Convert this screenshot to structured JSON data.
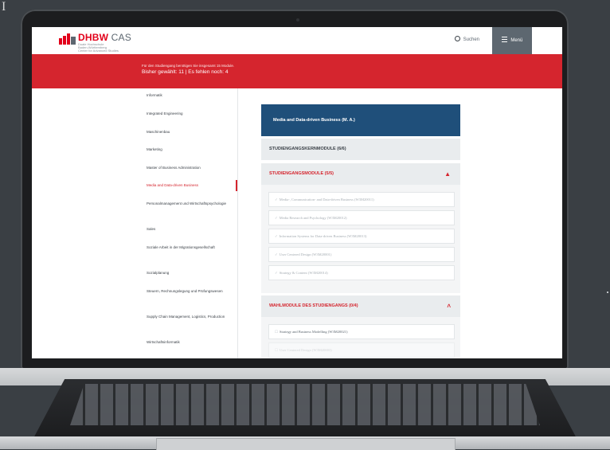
{
  "corner_text": "I",
  "header": {
    "logo_text": "DHBW",
    "logo_suffix": "CAS",
    "logo_sub1": "Duale Hochschule",
    "logo_sub2": "Baden-Württemberg",
    "logo_sub3": "Center for Advanced Studies",
    "search_label": "Suchen",
    "menu_label": "Menü"
  },
  "banner": {
    "line1": "Für den Studiengang benötigen Sie insgesamt 15 Module.",
    "line2": "Bisher gewählt: 11 | Es fehlen noch: 4"
  },
  "sidebar": {
    "items": [
      {
        "label": "Informatik"
      },
      {
        "label": "Integrated Engineering"
      },
      {
        "label": "Maschinenbau"
      },
      {
        "label": "Marketing"
      },
      {
        "label": "Master of Business Administration"
      },
      {
        "label": "Media and Data-driven Business"
      },
      {
        "label": "Personalmanagement und Wirtschaftspsychologie"
      },
      {
        "label": "Sales"
      },
      {
        "label": "Soziale Arbeit in der Migrationsgesellschaft"
      },
      {
        "label": "Sozialplanung"
      },
      {
        "label": "Steuern, Rechnungslegung und Prüfungswesen"
      },
      {
        "label": "Supply Chain Management, Logistics, Production"
      },
      {
        "label": "Wirtschaftsinformatik"
      }
    ],
    "active_index": 5
  },
  "content": {
    "program_title": "Media and Data-driven Business (M. A.)",
    "kern": {
      "label": "STUDIENGANGSKERNMODULE (6/6)"
    },
    "pflicht": {
      "label": "STUDIENGANGSMODULE (5/5)",
      "items": [
        "Media-, Communication- and Data-driven Business (W3M20011)",
        "Media Research and Psychology (W3M20012)",
        "Information Systems for Data-driven Business (W3M20013)",
        "User Centered Design (W3M20001)",
        "Strategy & Content (W3M20014)"
      ]
    },
    "wahl": {
      "label": "WAHLMODULE DES STUDIENGANGS (0/4)",
      "items": [
        "Strategy and Business Modelling (W3M20021)",
        "User Centered Design (W3M20003)"
      ]
    }
  },
  "colors": {
    "brand_red": "#d5252e",
    "navy": "#1f4f7a",
    "slate": "#5d6770"
  }
}
